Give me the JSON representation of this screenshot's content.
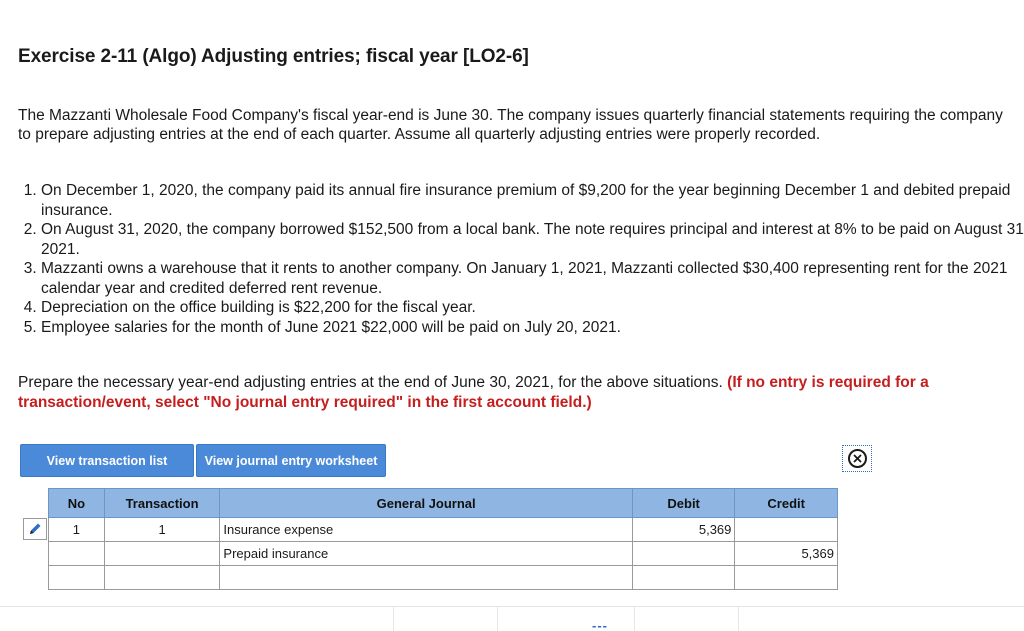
{
  "exercise": {
    "title": "Exercise 2-11 (Algo) Adjusting entries; fiscal year [LO2-6]",
    "intro": "The Mazzanti Wholesale Food Company's fiscal year-end is June 30. The company issues quarterly financial statements requiring the company to prepare adjusting entries at the end of each quarter. Assume all quarterly adjusting entries were properly recorded.",
    "items": [
      "On December 1, 2020, the company paid its annual fire insurance premium of $9,200 for the year beginning December 1  and debited prepaid insurance.",
      "On August 31, 2020, the company borrowed $152,500 from a local bank. The note requires principal and interest at 8% to be paid on August 31, 2021.",
      "Mazzanti owns a warehouse that it rents to another company. On January 1, 2021, Mazzanti collected $30,400 representing rent for the 2021 calendar year and credited deferred rent revenue.",
      "Depreciation on the office building is $22,200 for the fiscal year.",
      "Employee salaries for the month of June 2021 $22,000 will be paid on July 20, 2021."
    ],
    "prompt": "Prepare the necessary year-end adjusting entries at the end of June 30, 2021, for the above situations. ",
    "prompt_note": "(If no entry is required for a transaction/event, select \"No journal entry required\" in the first account field.)"
  },
  "toolbar": {
    "view_transaction_list": "View transaction list",
    "view_journal_worksheet": "View journal entry worksheet",
    "close_icon": "⊗"
  },
  "journal": {
    "headers": {
      "no": "No",
      "transaction": "Transaction",
      "general_journal": "General Journal",
      "debit": "Debit",
      "credit": "Credit"
    },
    "rows": [
      {
        "no": "1",
        "transaction": "1",
        "account": "Insurance expense",
        "debit": "5,369",
        "credit": ""
      },
      {
        "no": "",
        "transaction": "",
        "account": "Prepaid insurance",
        "debit": "",
        "credit": "5,369"
      },
      {
        "no": "",
        "transaction": "",
        "account": "",
        "debit": "",
        "credit": ""
      }
    ]
  },
  "footer": {
    "dashes": "---"
  },
  "colors": {
    "button_bg": "#4b8ad9",
    "header_bg": "#8fb5e3",
    "note_red": "#c41e1e"
  },
  "icons": [
    "pencil-icon",
    "close-circle-icon"
  ]
}
